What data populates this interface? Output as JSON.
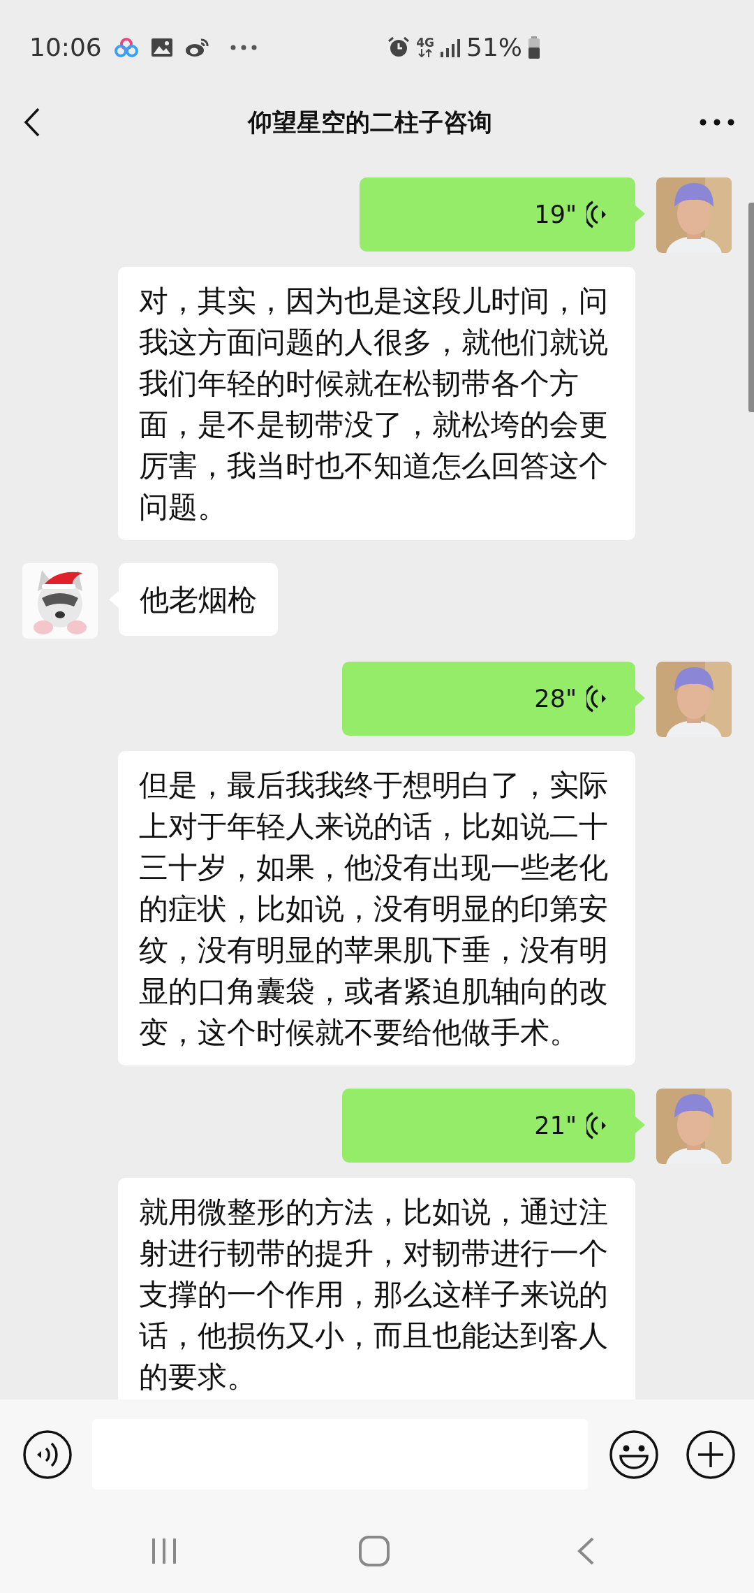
{
  "status_bar": {
    "time": "10:06",
    "network_type": "4G",
    "battery": "51%"
  },
  "header": {
    "title": "仰望星空的二柱子咨询"
  },
  "messages": [
    {
      "kind": "voice",
      "outgoing": true,
      "duration": "19\""
    },
    {
      "kind": "transcript",
      "lines": [
        "对，其实，因为也是这段儿时间，问",
        "我这方面问题的人很多，就他们就说",
        "我们年轻的时候就在松韧带各个方",
        "面，是不是韧带没了，就松垮的会更",
        "厉害，我当时也不知道怎么回答这个",
        "问题。"
      ]
    },
    {
      "kind": "text",
      "outgoing": false,
      "text": "他老烟枪"
    },
    {
      "kind": "voice",
      "outgoing": true,
      "duration": "28\""
    },
    {
      "kind": "transcript",
      "lines": [
        "但是，最后我我终于想明白了，实际",
        "上对于年轻人来说的话，比如说二十",
        "三十岁，如果，他没有出现一些老化",
        "的症状，比如说，没有明显的印第安",
        "纹，没有明显的苹果肌下垂，没有明",
        "显的口角囊袋，或者紧迫肌轴向的改",
        "变，这个时候就不要给他做手术。"
      ]
    },
    {
      "kind": "voice",
      "outgoing": true,
      "duration": "21\""
    },
    {
      "kind": "transcript",
      "lines": [
        "就用微整形的方法，比如说，通过注",
        "射进行韧带的提升，对韧带进行一个",
        "支撑的一个作用，那么这样子来说的",
        "话，他损伤又小，而且也能达到客人",
        "的要求。"
      ]
    }
  ]
}
